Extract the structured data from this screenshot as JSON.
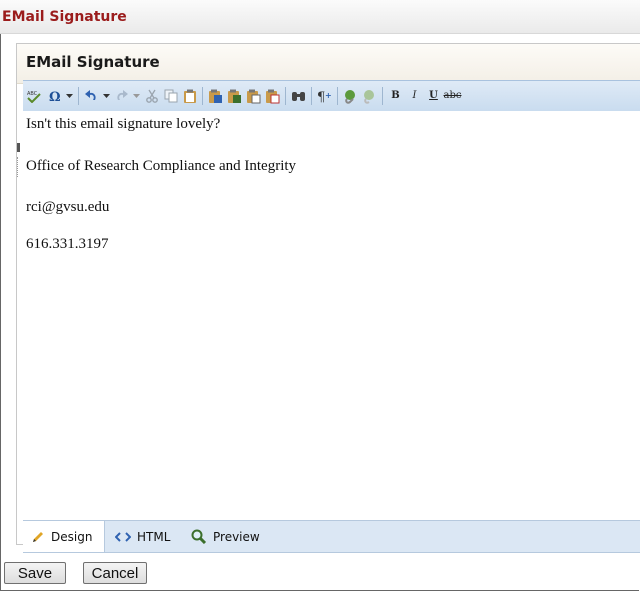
{
  "window": {
    "title": "EMail Signature"
  },
  "panel": {
    "title": "EMail Signature"
  },
  "toolbar": {
    "items": [
      {
        "name": "spell-check-icon",
        "glyph": "ABC"
      },
      {
        "name": "special-characters-icon",
        "glyph": "Ω"
      },
      {
        "name": "undo-icon",
        "glyph": "↶"
      },
      {
        "name": "redo-icon",
        "glyph": "↷"
      },
      {
        "name": "cut-icon",
        "glyph": "✂"
      },
      {
        "name": "copy-icon",
        "glyph": "⧉"
      },
      {
        "name": "paste-icon",
        "glyph": "📋"
      },
      {
        "name": "find-icon",
        "glyph": "🔍"
      },
      {
        "name": "formatting-marks-icon",
        "glyph": "¶"
      },
      {
        "name": "link-icon",
        "glyph": "🔗"
      },
      {
        "name": "unlink-icon",
        "glyph": "🔗"
      },
      {
        "name": "bold-button",
        "glyph": "B"
      },
      {
        "name": "italic-button",
        "glyph": "I"
      },
      {
        "name": "underline-button",
        "glyph": "U"
      },
      {
        "name": "strikethrough-button",
        "glyph": "abc"
      }
    ],
    "bold_label": "B",
    "italic_label": "I",
    "underline_label": "U",
    "strike_label": "abc"
  },
  "editor": {
    "lines": [
      "Isn't this email signature lovely?",
      "Office of Research Compliance and Integrity",
      "rci@gvsu.edu",
      "616.331.3197"
    ]
  },
  "modes": {
    "design": "Design",
    "html": "HTML",
    "preview": "Preview",
    "active": "design"
  },
  "actions": {
    "save": "Save",
    "cancel": "Cancel"
  },
  "colors": {
    "title_red": "#9b1c1c",
    "toolbar_blue": "#c9dcef",
    "mode_bar_blue": "#dbe7f4"
  }
}
